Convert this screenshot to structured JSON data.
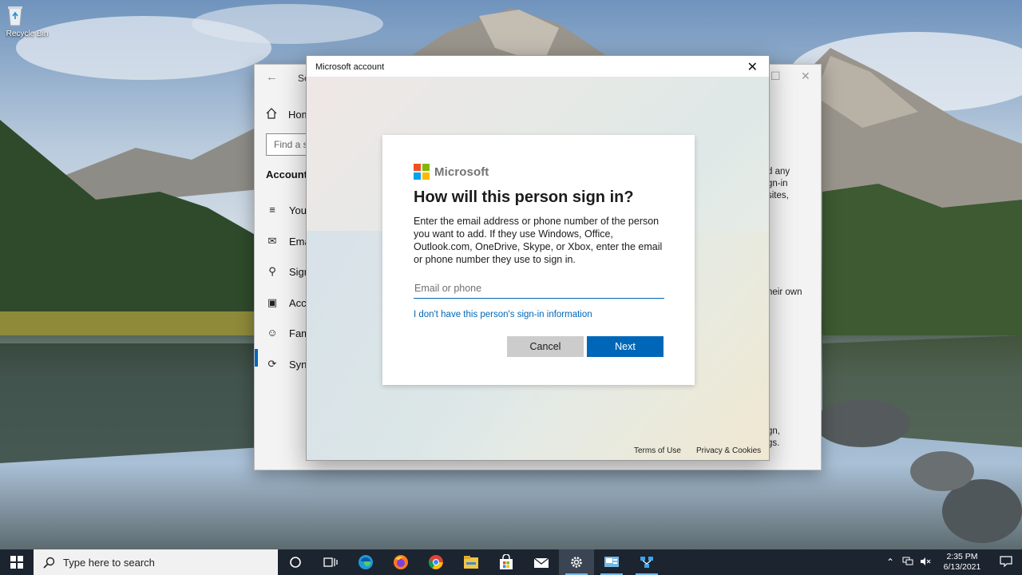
{
  "desktop": {
    "recycle_bin_label": "Recycle Bin"
  },
  "settings_window": {
    "title": "Se",
    "home_label": "Hom",
    "search_placeholder": "Find a s",
    "section_label": "Accounts",
    "nav_items": [
      {
        "label": "Your",
        "icon": "person-info-icon"
      },
      {
        "label": "Ema",
        "icon": "email-icon"
      },
      {
        "label": "Sign",
        "icon": "key-icon"
      },
      {
        "label": "Acce",
        "icon": "briefcase-icon"
      },
      {
        "label": "Fami",
        "icon": "add-person-icon"
      },
      {
        "label": "Sync",
        "icon": "sync-icon"
      }
    ],
    "right_text_1": [
      "d any",
      "gn-in",
      "sites,"
    ],
    "right_text_2": "heir own",
    "right_text_3": [
      "gn,",
      "gs."
    ]
  },
  "dialog": {
    "title": "Microsoft account",
    "brand": "Microsoft",
    "heading": "How will this person sign in?",
    "description": "Enter the email address or phone number of the person you want to add. If they use Windows, Office, Outlook.com, OneDrive, Skype, or Xbox, enter the email or phone number they use to sign in.",
    "email_placeholder": "Email or phone",
    "email_value": "",
    "no_info_link": "I don't have this person's sign-in information",
    "cancel_label": "Cancel",
    "next_label": "Next",
    "terms_label": "Terms of Use",
    "privacy_label": "Privacy & Cookies",
    "logo_colors": [
      "#f25022",
      "#7fba00",
      "#00a4ef",
      "#ffb900"
    ]
  },
  "taskbar": {
    "search_placeholder": "Type here to search",
    "time": "2:35 PM",
    "date": "6/13/2021",
    "accent_color": "#0067b8"
  }
}
